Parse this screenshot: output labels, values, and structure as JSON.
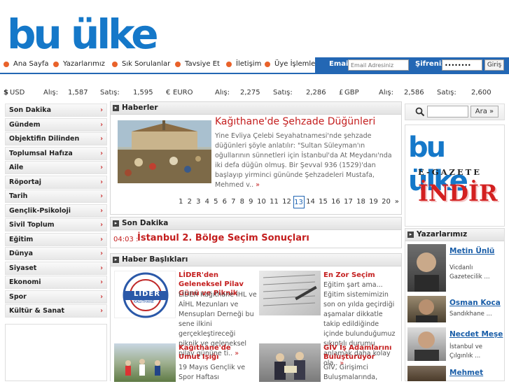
{
  "logo": {
    "text": "bu ülke"
  },
  "nav": {
    "items": [
      "Ana Sayfa",
      "Yazarlarımız",
      "Sık Sorulanlar",
      "Tavsiye Et",
      "İletişim",
      "Üye İşlemleri"
    ]
  },
  "login": {
    "email_label": "Email",
    "email_placeholder": "Email Adresiniz",
    "password_label": "Şifreniz",
    "password_value": "••••••••",
    "button": "Giriş"
  },
  "currency": {
    "usd_symbol": "$",
    "usd": "USD",
    "usd_alis_label": "Alış:",
    "usd_alis": "1,587",
    "usd_satis_label": "Satış:",
    "usd_satis": "1,595",
    "eur_symbol": "€",
    "eur": "EURO",
    "eur_alis_label": "Alış:",
    "eur_alis": "2,275",
    "eur_satis_label": "Satış:",
    "eur_satis": "2,286",
    "gbp_symbol": "£",
    "gbp": "GBP",
    "gbp_alis_label": "Alış:",
    "gbp_alis": "2,586",
    "gbp_satis_label": "Satış:",
    "gbp_satis": "2,600"
  },
  "sidebar": {
    "items": [
      "Son Dakika",
      "Gündem",
      "Objektifin Dilinden",
      "Toplumsal Hafıza",
      "Aile",
      "Röportaj",
      "Tarih",
      "Gençlik-Psikoloji",
      "Sivil Toplum",
      "Eğitim",
      "Dünya",
      "Siyaset",
      "Ekonomi",
      "Spor",
      "Kültür & Sanat"
    ],
    "arrow": "›"
  },
  "haberler": {
    "title": "Haberler",
    "headline": "Kağıthane'de Şehzade Düğünleri",
    "text": "Yine Evliya Çelebi Seyahatnamesi'nde şehzade düğünleri şöyle anlatılır: \"Sultan Süleyman'ın oğullarının sünnetleri için İstanbul'da At Meydanı'nda iki defa düğün olmuş. Bir Şevval 936 (1529)'dan başlayıp yirminci gününde Şehzadeleri Mustafa, Mehmed v..",
    "more": "»",
    "pages": [
      "1",
      "2",
      "3",
      "4",
      "5",
      "6",
      "7",
      "8",
      "9",
      "10",
      "11",
      "12",
      "13",
      "14",
      "15",
      "16",
      "17",
      "18",
      "19",
      "20",
      "»"
    ],
    "current_page": "13"
  },
  "son_dakika": {
    "title": "Son Dakika",
    "time": "04:03 :",
    "text": "İstanbul 2. Bölge Seçim Sonuçları"
  },
  "haber_basliklari": {
    "title": "Haber Başlıkları",
    "items": [
      {
        "title": "LİDER'den Geleneksel Pilav Günü ve Piknik",
        "text": "LİDER Kağıthane İHL ve AİHL Mezunları ve Mensupları Derneği bu sene ilkini gerçekleştireceği piknik ve geleneksel pilav gününe ti..",
        "more": "»",
        "logo_text": "LİDER",
        "logo_sub": "KAĞITHANE"
      },
      {
        "title": "En Zor Seçim",
        "text": "Eğitim şart ama... Eğitim sistemimizin son on yılda geçirdiği aşamalar dikkatle takip edildiğinde içinde bulunduğumuz sıkıntılı durumu anlamak daha kolay ola..",
        "more": "»"
      },
      {
        "title": "Kağıthane'de Umut Işığı",
        "text": "19 Mayıs Gençlik ve Spor Haftası"
      },
      {
        "title": "GİV İş Adamlarını Buluşturuyor",
        "text": "GİV, Girişimci Buluşmalarında,"
      }
    ]
  },
  "search": {
    "button": "Ara »"
  },
  "egazete": {
    "logo": "bu ülke",
    "sub": "E-GAZETE",
    "indir": "İNDİR"
  },
  "authors": {
    "title": "Yazarlarımız",
    "items": [
      {
        "name": "Metin Ünlü",
        "desc1": "Vicdanlı",
        "desc2": "Gazetecilik ..."
      },
      {
        "name": "Osman Koca",
        "desc1": "Sandıkhane ...",
        "desc2": ""
      },
      {
        "name": "Necdet Meşe",
        "desc1": "İstanbul ve",
        "desc2": "Çılgınlık ..."
      },
      {
        "name": "Mehmet",
        "desc1": "",
        "desc2": ""
      }
    ]
  }
}
